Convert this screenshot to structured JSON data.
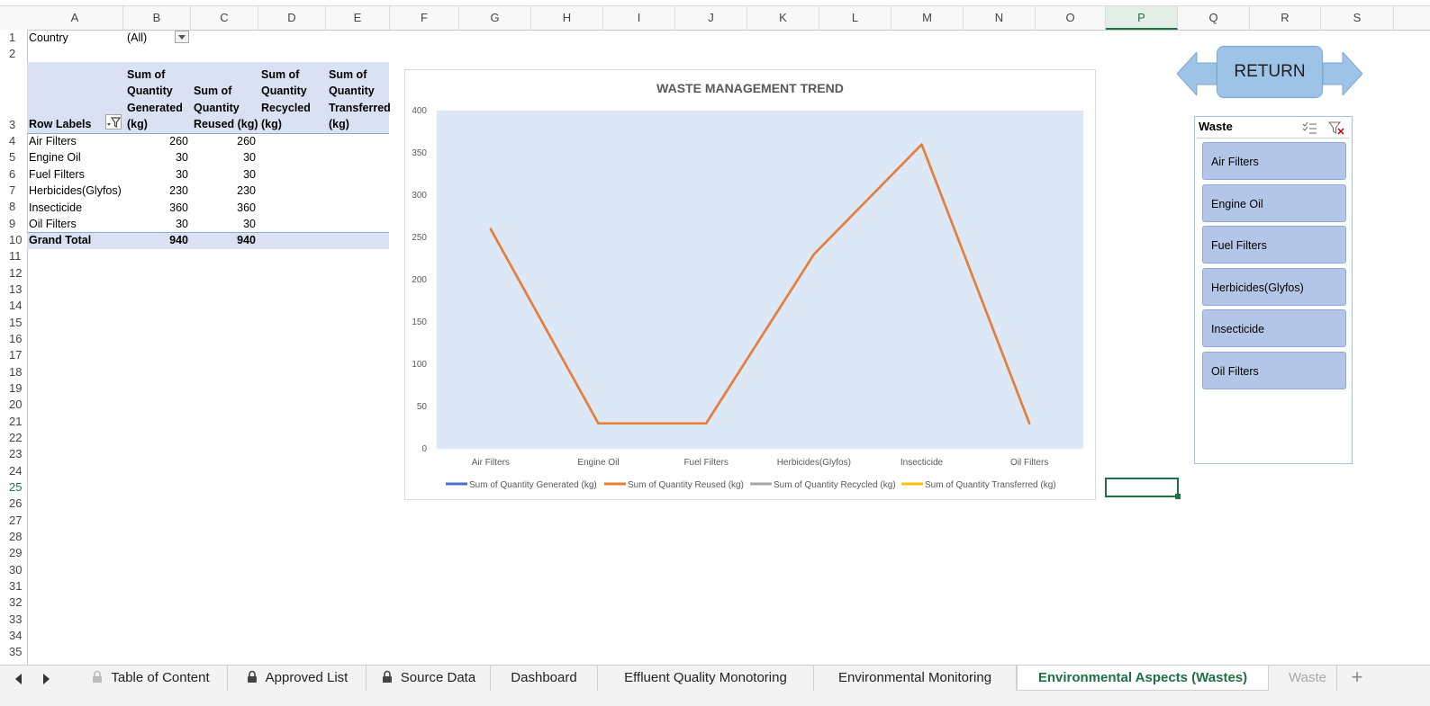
{
  "columns": [
    "A",
    "B",
    "C",
    "D",
    "E",
    "F",
    "G",
    "H",
    "I",
    "J",
    "K",
    "L",
    "M",
    "N",
    "O",
    "P",
    "Q",
    "R",
    "S"
  ],
  "active_column": "P",
  "rows": [
    "1",
    "2",
    "3",
    "4",
    "5",
    "6",
    "7",
    "8",
    "9",
    "10",
    "11",
    "12",
    "13",
    "14",
    "15",
    "16",
    "17",
    "18",
    "19",
    "20",
    "21",
    "22",
    "23",
    "24",
    "25",
    "26",
    "27",
    "28",
    "29",
    "30",
    "31",
    "32",
    "33",
    "34",
    "35"
  ],
  "active_row": "25",
  "pivot": {
    "filter_label": "Country",
    "filter_value": "(All)",
    "row_labels": "Row Labels",
    "headers": [
      [
        "Sum of",
        "Quantity",
        "Generated",
        "(kg)"
      ],
      [
        "Sum of",
        "Quantity",
        "Reused (kg)"
      ],
      [
        "Sum of",
        "Quantity",
        "Recycled",
        "(kg)"
      ],
      [
        "Sum of",
        "Quantity",
        "Transferred",
        "(kg)"
      ]
    ],
    "rows": [
      {
        "label": "Air Filters",
        "generated": "260",
        "reused": "260"
      },
      {
        "label": "Engine Oil",
        "generated": "30",
        "reused": "30"
      },
      {
        "label": "Fuel Filters",
        "generated": "30",
        "reused": "30"
      },
      {
        "label": "Herbicides(Glyfos)",
        "generated": "230",
        "reused": "230"
      },
      {
        "label": "Insecticide",
        "generated": "360",
        "reused": "360"
      },
      {
        "label": "Oil Filters",
        "generated": "30",
        "reused": "30"
      }
    ],
    "total": {
      "label": "Grand Total",
      "generated": "940",
      "reused": "940"
    }
  },
  "chart_data": {
    "type": "line",
    "title": "WASTE MANAGEMENT TREND",
    "categories": [
      "Air Filters",
      "Engine Oil",
      "Fuel Filters",
      "Herbicides(Glyfos)",
      "Insecticide",
      "Oil Filters"
    ],
    "ylim": [
      0,
      400
    ],
    "yticks": [
      "0",
      "50",
      "100",
      "150",
      "200",
      "250",
      "300",
      "350",
      "400"
    ],
    "series": [
      {
        "name": "Sum of Quantity Generated (kg)",
        "color": "#4472c4",
        "values": [
          260,
          30,
          30,
          230,
          360,
          30
        ],
        "hidden_behind": true
      },
      {
        "name": "Sum of Quantity Reused (kg)",
        "color": "#ed7d31",
        "values": [
          260,
          30,
          30,
          230,
          360,
          30
        ]
      },
      {
        "name": "Sum of Quantity Recycled (kg)",
        "color": "#a5a5a5",
        "values": []
      },
      {
        "name": "Sum of Quantity Transferred (kg)",
        "color": "#ffc000",
        "values": []
      }
    ],
    "legend": "bottom",
    "plot_bg": "#dde8f6"
  },
  "return_label": "RETURN",
  "slicer": {
    "title": "Waste",
    "items": [
      "Air Filters",
      "Engine Oil",
      "Fuel Filters",
      "Herbicides(Glyfos)",
      "Insecticide",
      "Oil Filters"
    ]
  },
  "tabs": [
    {
      "label": "Table of Content",
      "locked": true
    },
    {
      "label": "Approved List",
      "locked": true
    },
    {
      "label": "Source Data",
      "locked": true
    },
    {
      "label": "Dashboard",
      "locked": false
    },
    {
      "label": "Effluent Quality Monotoring",
      "locked": false
    },
    {
      "label": "Environmental Monitoring",
      "locked": false
    },
    {
      "label": "Environmental Aspects (Wastes)",
      "locked": false,
      "active": true
    },
    {
      "label": "Waste",
      "locked": false
    }
  ],
  "colors": {
    "accent": "#1e7145",
    "header_band": "#d9e1f2",
    "slicer_item": "#b4c6e7",
    "return_shape": "#9dc3e6"
  }
}
